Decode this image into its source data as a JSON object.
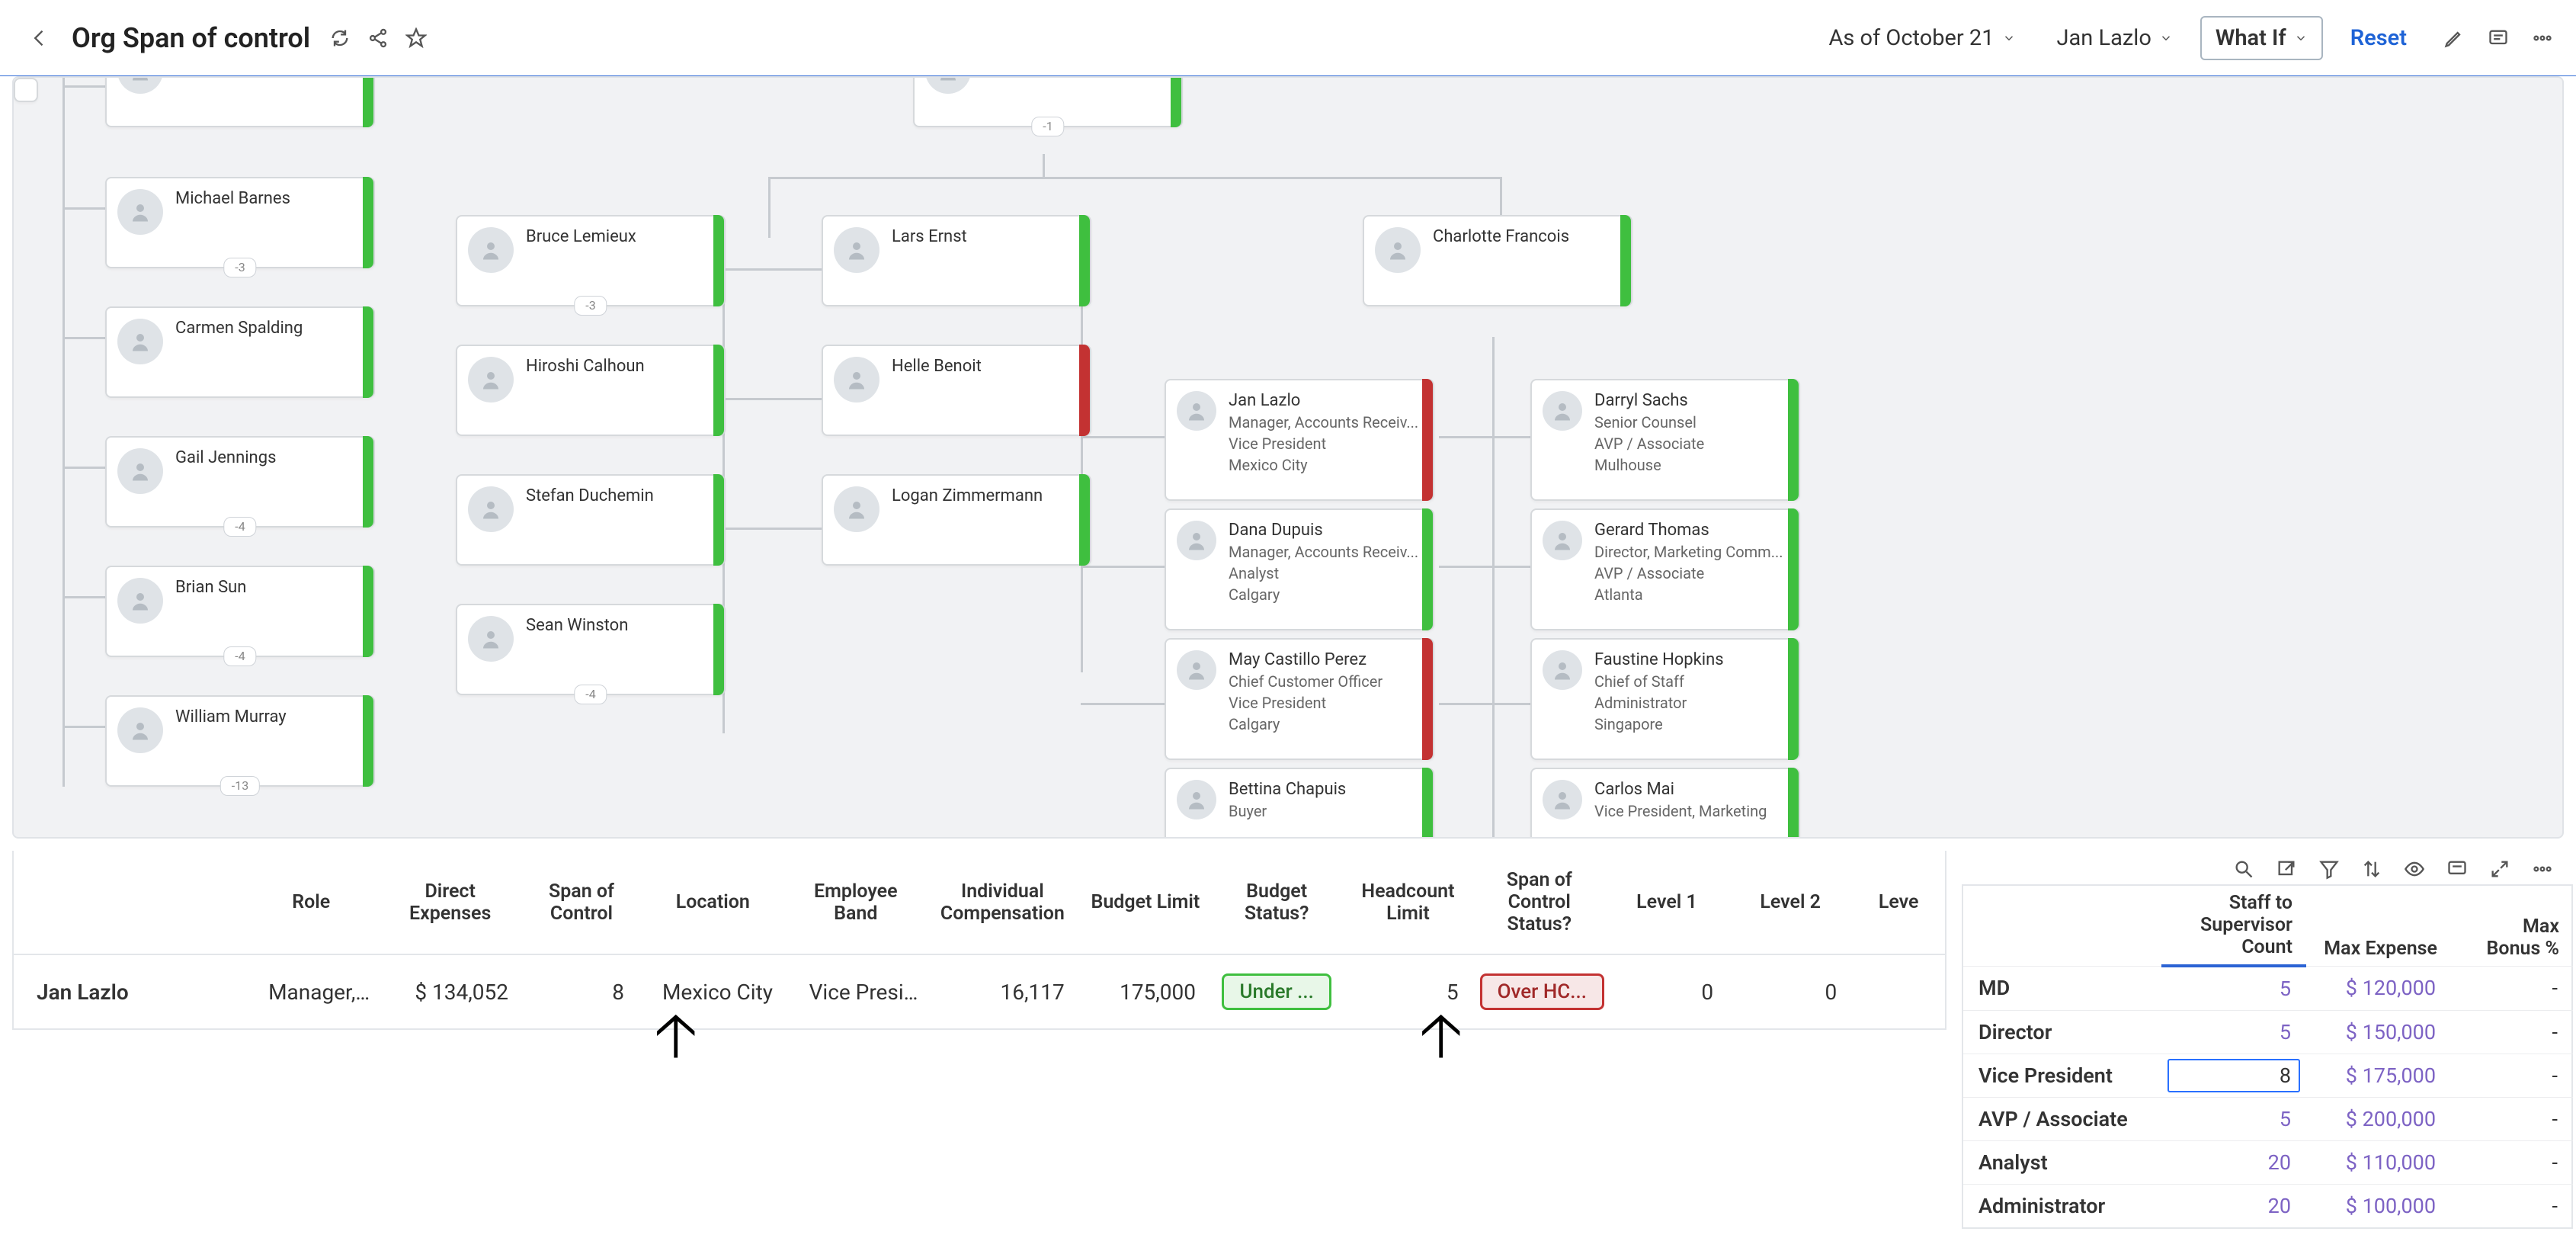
{
  "header": {
    "title": "Org Span of control",
    "as_of": "As of October 21",
    "user": "Jan Lazlo",
    "whatif": "What If",
    "reset": "Reset"
  },
  "nodes": {
    "top1": {
      "name": "",
      "badge": "",
      "bar": "green"
    },
    "top2": {
      "name": "",
      "badge": "-1",
      "bar": "green"
    },
    "l1": {
      "name": "Michael Barnes",
      "badge": "-3",
      "bar": "green"
    },
    "l2": {
      "name": "Carmen Spalding",
      "badge": "",
      "bar": "green"
    },
    "l3": {
      "name": "Gail Jennings",
      "badge": "-4",
      "bar": "green"
    },
    "l4": {
      "name": "Brian Sun",
      "badge": "-4",
      "bar": "green"
    },
    "l5": {
      "name": "William Murray",
      "badge": "-13",
      "bar": "green"
    },
    "m1": {
      "name": "Bruce Lemieux",
      "badge": "-3",
      "bar": "green"
    },
    "m2": {
      "name": "Hiroshi Calhoun",
      "badge": "",
      "bar": "green"
    },
    "m3": {
      "name": "Stefan Duchemin",
      "badge": "",
      "bar": "green"
    },
    "m4": {
      "name": "Sean Winston",
      "badge": "-4",
      "bar": "green"
    },
    "c1": {
      "name": "Lars Ernst",
      "badge": "",
      "bar": "green"
    },
    "c2": {
      "name": "Helle Benoit",
      "badge": "",
      "bar": "red"
    },
    "c3": {
      "name": "Logan Zimmermann",
      "badge": "",
      "bar": "green"
    },
    "cf": {
      "name": "Charlotte Francois",
      "badge": "",
      "bar": "green"
    },
    "r1": {
      "name": "Jan Lazlo",
      "l2": "Manager, Accounts Receiv...",
      "l3": "Vice President",
      "l4": "Mexico City",
      "bar": "red"
    },
    "r2": {
      "name": "Dana Dupuis",
      "l2": "Manager, Accounts Receiv...",
      "l3": "Analyst",
      "l4": "Calgary",
      "bar": "green"
    },
    "r3": {
      "name": "May Castillo Perez",
      "l2": "Chief Customer Officer",
      "l3": "Vice President",
      "l4": "Calgary",
      "bar": "red"
    },
    "r4": {
      "name": "Bettina Chapuis",
      "l2": "Buyer",
      "l3": "",
      "l4": "",
      "bar": "green"
    },
    "s1": {
      "name": "Darryl Sachs",
      "l2": "Senior Counsel",
      "l3": "AVP / Associate",
      "l4": "Mulhouse",
      "bar": "green"
    },
    "s2": {
      "name": "Gerard Thomas",
      "l2": "Director, Marketing Comm...",
      "l3": "AVP / Associate",
      "l4": "Atlanta",
      "bar": "green"
    },
    "s3": {
      "name": "Faustine Hopkins",
      "l2": "Chief of Staff",
      "l3": "Administrator",
      "l4": "Singapore",
      "bar": "green"
    },
    "s4": {
      "name": "Carlos Mai",
      "l2": "Vice President, Marketing",
      "l3": "",
      "l4": "",
      "bar": "green"
    }
  },
  "detail": {
    "headers": {
      "name": "",
      "role": "Role",
      "expenses": "Direct Expenses",
      "span": "Span of Control",
      "location": "Location",
      "band": "Employee Band",
      "comp": "Individual Compensation",
      "budget": "Budget Limit",
      "bstatus": "Budget Status?",
      "hclimit": "Headcount Limit",
      "hcstatus": "Span of Control Status?",
      "lvl1": "Level 1",
      "lvl2": "Level 2",
      "lvl3": "Leve"
    },
    "row": {
      "name": "Jan Lazlo",
      "role": "Manager, ...",
      "expenses": "$ 134,052",
      "span": "8",
      "location": "Mexico City",
      "band": "Vice Presi...",
      "comp": "16,117",
      "budget": "175,000",
      "bstatus": "Under ...",
      "hclimit": "5",
      "hcstatus": "Over HC...",
      "lvl1": "0",
      "lvl2": "0",
      "lvl3": ""
    }
  },
  "right": {
    "headers": {
      "col1": "",
      "col2": "Staff to Supervisor Count",
      "col3": "Max Expense",
      "col4": "Max Bonus %"
    },
    "rows": [
      {
        "lab": "MD",
        "count": "5",
        "exp": "$ 120,000",
        "bonus": "-"
      },
      {
        "lab": "Director",
        "count": "5",
        "exp": "$ 150,000",
        "bonus": "-"
      },
      {
        "lab": "Vice President",
        "count": "8",
        "exp": "$ 175,000",
        "bonus": "-"
      },
      {
        "lab": "AVP / Associate",
        "count": "5",
        "exp": "$ 200,000",
        "bonus": "-"
      },
      {
        "lab": "Analyst",
        "count": "20",
        "exp": "$ 110,000",
        "bonus": "-"
      },
      {
        "lab": "Administrator",
        "count": "20",
        "exp": "$ 100,000",
        "bonus": "-"
      }
    ],
    "editing_row": 2
  }
}
